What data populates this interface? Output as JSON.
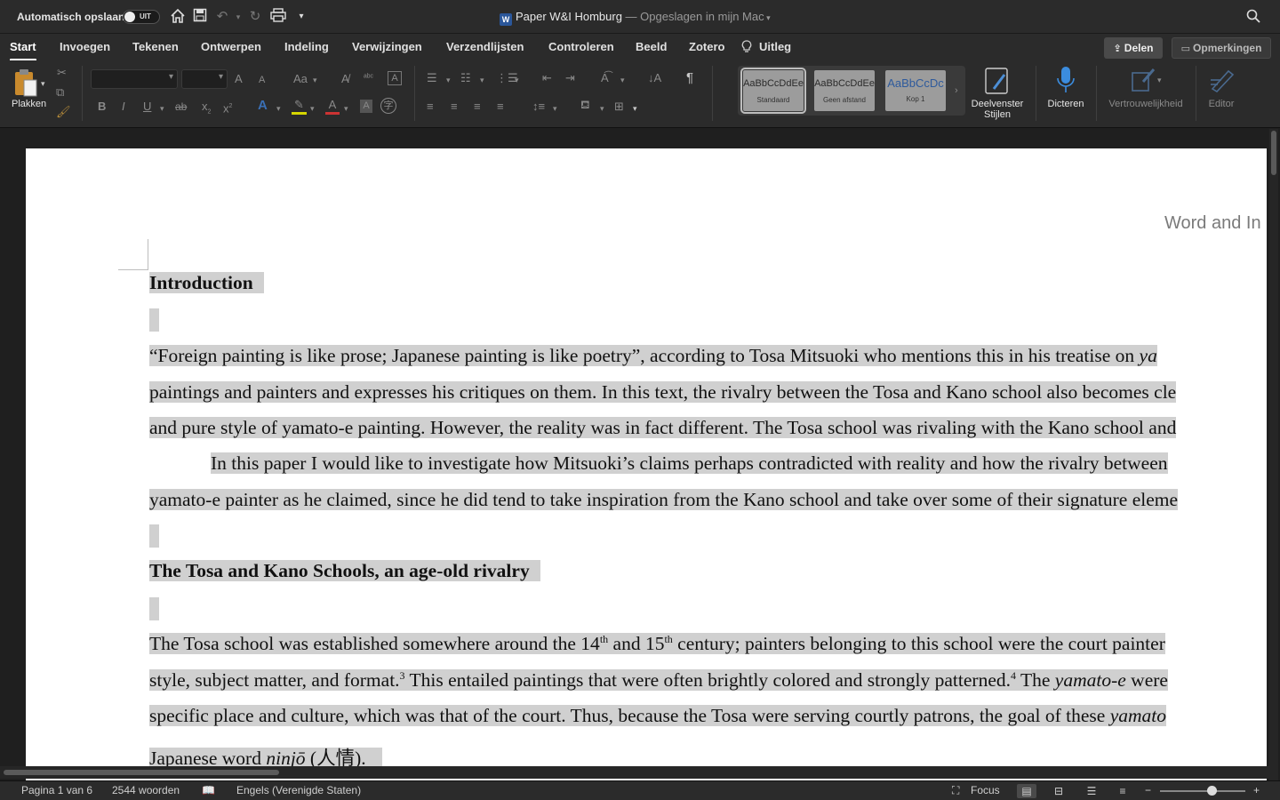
{
  "titlebar": {
    "autosave_label": "Automatisch opslaan",
    "autosave_state": "UIT",
    "document_name": "Paper W&I Homburg",
    "saved_status": " — Opgeslagen in mijn Mac",
    "word_icon": "W"
  },
  "tabs": [
    "Start",
    "Invoegen",
    "Tekenen",
    "Ontwerpen",
    "Indeling",
    "Verwijzingen",
    "Verzendlijsten",
    "Controleren",
    "Beeld",
    "Zotero",
    "Uitleg"
  ],
  "active_tab": "Start",
  "share_label": "Delen",
  "comments_label": "Opmerkingen",
  "ribbon": {
    "paste_label": "Plakken",
    "styles": [
      {
        "sample": "AaBbCcDdEe",
        "name": "Standaard"
      },
      {
        "sample": "AaBbCcDdEe",
        "name": "Geen afstand"
      },
      {
        "sample": "AaBbCcDc",
        "name": "Kop 1"
      }
    ],
    "styles_pane_label_1": "Deelvenster",
    "styles_pane_label_2": "Stijlen",
    "dictate_label": "Dicteren",
    "sensitivity_label": "Vertrouwelijkheid",
    "editor_label": "Editor",
    "bold": "B",
    "italic": "I",
    "underline": "U",
    "strike": "ab",
    "subscript": "x",
    "superscript": "x",
    "font_grow": "A",
    "font_shrink": "A",
    "change_case": "Aa",
    "pilcrow": "¶"
  },
  "document": {
    "header_text": "Word and In",
    "heading1": "Introduction",
    "p1_line1_a": "“Foreign painting is like prose; Japanese painting is like poetry”, according to Tosa Mitsuoki who mentions this in his treatise on ",
    "p1_line1_b": "ya",
    "p1_line2": "paintings and painters and expresses his critiques on them. In this text, the rivalry between the Tosa and Kano school also becomes cle",
    "p1_line3": "and pure style of yamato-e painting. However, the reality was in fact different. The Tosa school was rivaling with the Kano school and",
    "p2_line1": "In this paper I would like to investigate how Mitsuoki’s claims perhaps contradicted with reality and how the rivalry between",
    "p2_line2": "yamato-e painter as he claimed, since he did tend to take inspiration from the Kano school and take over some of their signature eleme",
    "heading2": "The Tosa and Kano Schools, an age-old rivalry",
    "p3_line1_a": "The Tosa school was established somewhere around the 14",
    "p3_line1_sup1": "th",
    "p3_line1_b": " and 15",
    "p3_line1_sup2": "th",
    "p3_line1_c": " century; painters belonging to this school were the court painter",
    "p3_line2_a": "style, subject matter, and format.",
    "p3_line2_sup1": "3",
    "p3_line2_b": " This entailed paintings that were often brightly colored and strongly patterned.",
    "p3_line2_sup2": "4",
    "p3_line2_c": " The ",
    "p3_line2_d": "yamato-e",
    "p3_line2_e": " were",
    "p3_line3_a": "specific place and culture, which was that of the court. Thus, because the Tosa were serving courtly patrons, the goal of these ",
    "p3_line3_b": "yamato",
    "p3_line4_a": "Japanese word ",
    "p3_line4_b": "ninjō",
    "p3_line4_c": " (人情)."
  },
  "statusbar": {
    "page_info": "Pagina 1 van 6",
    "word_count": "2544 woorden",
    "language": "Engels (Verenigde Staten)",
    "focus_label": "Focus",
    "zoom_minus": "−",
    "zoom_plus": "+"
  },
  "colors": {
    "chrome_bg": "#2b2b2b",
    "page_bg": "#ffffff",
    "selection_highlight": "#d0d0d0",
    "word_blue": "#2b579a",
    "mic_blue": "#3b8cde"
  },
  "icons": [
    "home-icon",
    "save-icon",
    "undo-icon",
    "redo-icon",
    "print-icon",
    "customize-toolbar-icon",
    "search-icon",
    "lightbulb-icon",
    "share-icon",
    "comment-icon",
    "paste-icon",
    "cut-icon",
    "copy-icon",
    "format-painter-icon",
    "microphone-icon",
    "editor-pen-icon",
    "focus-icon",
    "print-layout-icon",
    "web-layout-icon",
    "outline-icon",
    "draft-icon"
  ]
}
